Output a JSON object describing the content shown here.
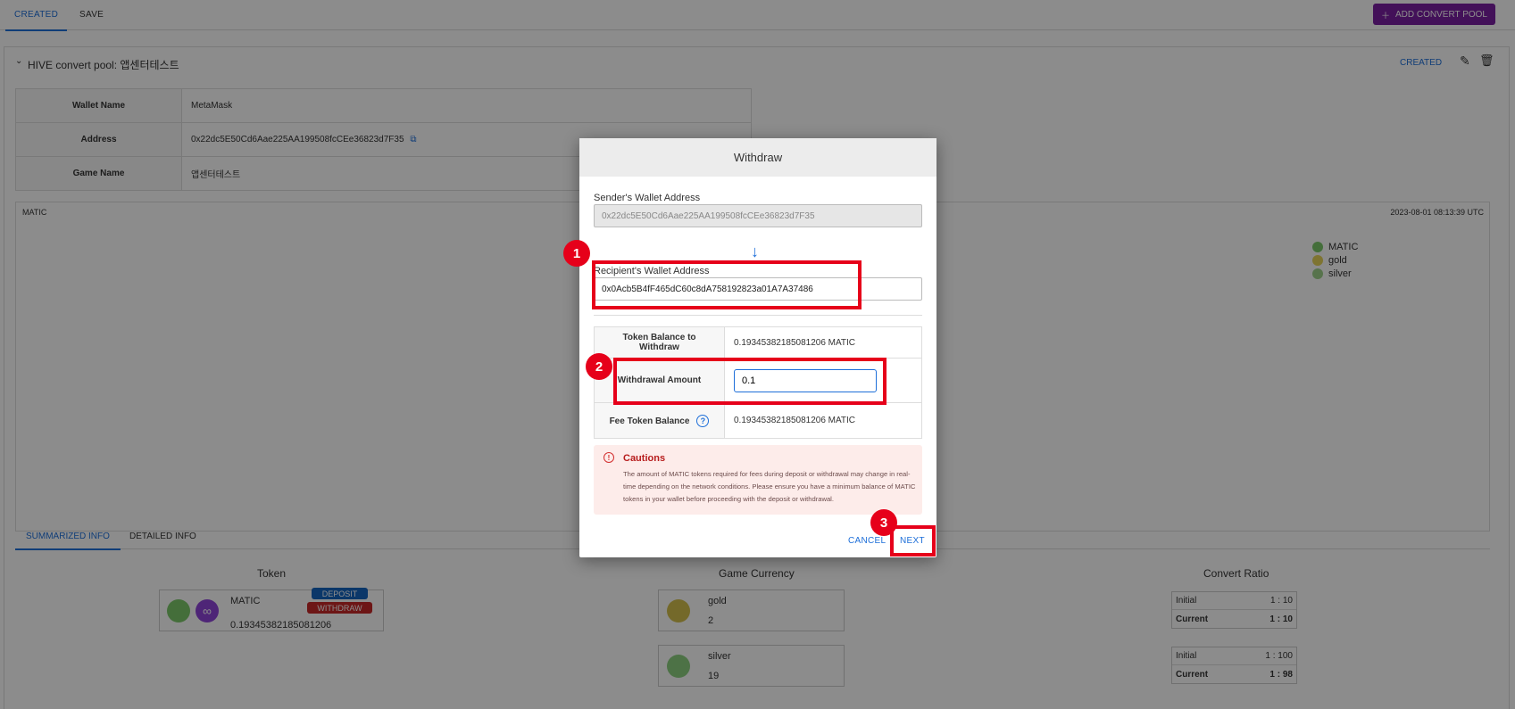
{
  "top_tabs": [
    {
      "label": "CREATED"
    },
    {
      "label": "SAVE"
    }
  ],
  "add_button": {
    "label": "ADD CONVERT POOL"
  },
  "pool": {
    "title": "HIVE convert pool: 앱센터테스트",
    "status": "CREATED",
    "rows": [
      {
        "key": "Wallet Name",
        "value": "MetaMask"
      },
      {
        "key": "Address",
        "value": "0x22dc5E50Cd6Aae225AA199508fcCEe36823d7F35"
      },
      {
        "key": "Game Name",
        "value": "앱센터테스트"
      }
    ]
  },
  "chart": {
    "label": "MATIC",
    "timestamp": "2023-08-01 08:13:39 UTC",
    "legend": [
      {
        "name": "MATIC",
        "color": "#7cc96a"
      },
      {
        "name": "gold",
        "color": "#e6d35a"
      },
      {
        "name": "silver",
        "color": "#9fd28a"
      }
    ]
  },
  "bottom_tabs": [
    {
      "label": "SUMMARIZED INFO"
    },
    {
      "label": "DETAILED INFO"
    }
  ],
  "summary": {
    "token_title": "Token",
    "currency_title": "Game Currency",
    "ratio_title": "Convert Ratio",
    "token": {
      "name": "MATIC",
      "balance": "0.19345382185081206",
      "deposit": "DEPOSIT",
      "withdraw": "WITHDRAW"
    },
    "currencies": [
      {
        "name": "gold",
        "amount": "2",
        "color": "#d4c04e"
      },
      {
        "name": "silver",
        "amount": "19",
        "color": "#8ccf80"
      }
    ],
    "ratios": [
      {
        "initial_label": "Initial",
        "initial": "1 : 10",
        "current_label": "Current",
        "current": "1 : 10"
      },
      {
        "initial_label": "Initial",
        "initial": "1 : 100",
        "current_label": "Current",
        "current": "1 : 98"
      }
    ]
  },
  "dialog": {
    "title": "Withdraw",
    "sender_label": "Sender's Wallet Address",
    "sender_value": "0x22dc5E50Cd6Aae225AA199508fcCEe36823d7F35",
    "recipient_label": "Recipient's Wallet Address",
    "recipient_value": "0x0Acb5B4fF465dC60c8dA758192823a01A7A37486",
    "balance_label": "Token Balance to Withdraw",
    "balance_value": "0.19345382185081206 MATIC",
    "amount_label": "Withdrawal Amount",
    "amount_value": "0.1",
    "fee_label": "Fee Token Balance",
    "fee_value": "0.19345382185081206 MATIC",
    "caution_title": "Cautions",
    "caution_text": "The amount of MATIC tokens required for fees during deposit or withdrawal may change in real-time depending on the network conditions. Please ensure you have a minimum balance of MATIC tokens in your wallet before proceeding with the deposit or withdrawal.",
    "cancel_label": "CANCEL",
    "next_label": "NEXT"
  },
  "annotations": [
    "1",
    "2",
    "3"
  ]
}
